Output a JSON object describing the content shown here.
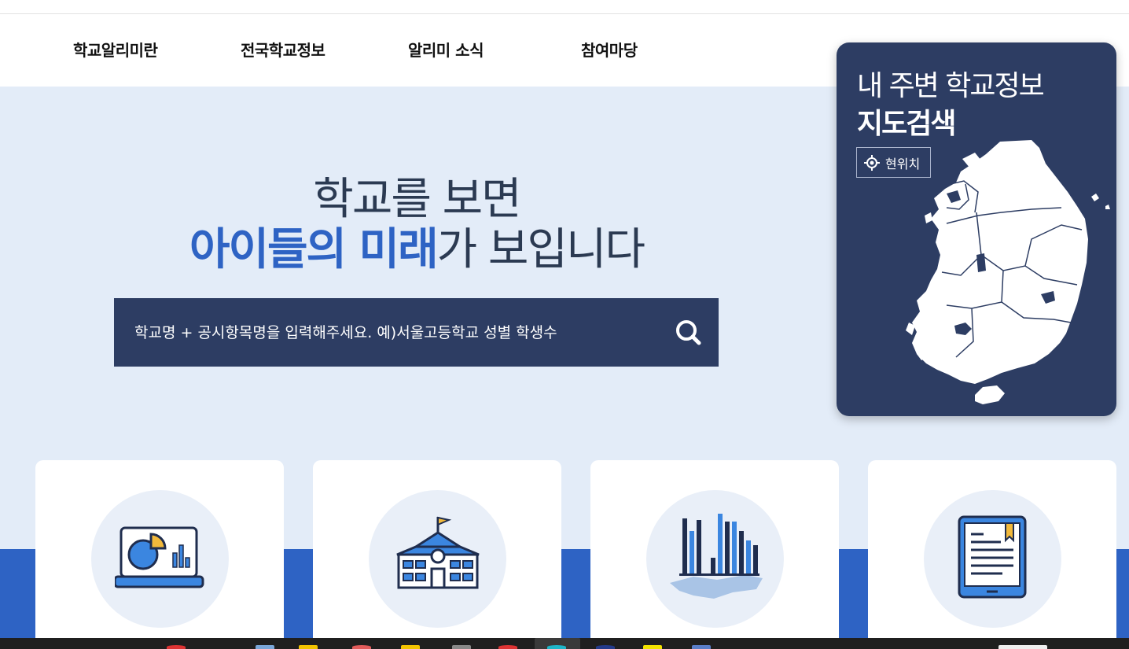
{
  "nav": {
    "items": [
      {
        "label": "학교알리미란"
      },
      {
        "label": "전국학교정보"
      },
      {
        "label": "알리미 소식"
      },
      {
        "label": "참여마당"
      }
    ]
  },
  "hero": {
    "line1": "학교를 보면",
    "line2_highlight": "아이들의 미래",
    "line2_rest": "가 보입니다"
  },
  "search": {
    "placeholder": "학교명 + 공시항목명을 입력해주세요. 예)서울고등학교 성별 학생수",
    "icon": "search-icon"
  },
  "map_card": {
    "title_line1": "내 주변 학교정보",
    "title_line2": "지도검색",
    "location_button": "현위치",
    "location_icon": "crosshair-icon"
  },
  "cards": [
    {
      "icon": "pie-chart-laptop-icon"
    },
    {
      "icon": "school-building-icon"
    },
    {
      "icon": "bar-chart-map-icon"
    },
    {
      "icon": "tablet-document-icon"
    }
  ],
  "colors": {
    "navy": "#2d3d63",
    "accent_blue": "#2e63c4",
    "hero_bg": "#e3ecf8",
    "circle_bg": "#e9eff8"
  }
}
